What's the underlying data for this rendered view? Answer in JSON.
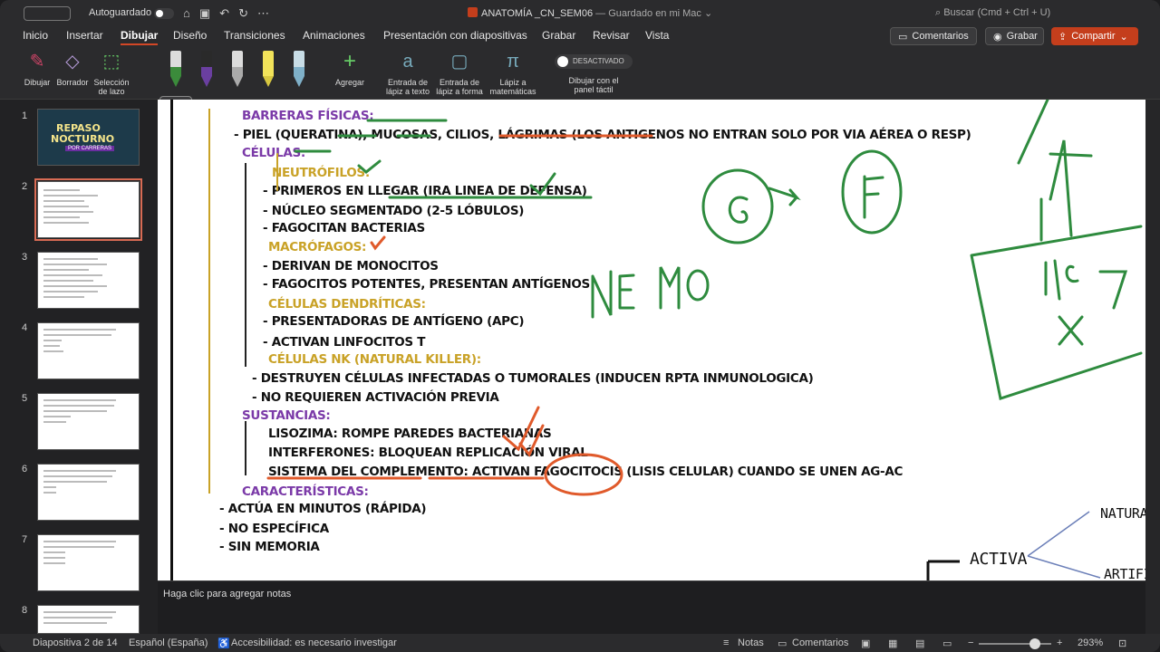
{
  "titlebar": {
    "autosave_label": "Autoguardado",
    "doc_title": "ANATOMÍA _CN_SEM06",
    "doc_status": " — Guardado en mi Mac ⌄",
    "search_label": "Buscar (Cmd + Ctrl + U)"
  },
  "menu": {
    "items": [
      "Inicio",
      "Insertar",
      "Dibujar",
      "Diseño",
      "Transiciones",
      "Animaciones",
      "Presentación con diapositivas",
      "Grabar",
      "Revisar",
      "Vista"
    ],
    "active": "Dibujar"
  },
  "header_buttons": {
    "comments": "Comentarios",
    "record": "Grabar",
    "share": "Compartir"
  },
  "ribbon": {
    "draw": "Dibujar",
    "eraser": "Borrador",
    "lasso": "Selección de lazo",
    "add": "Agregar",
    "ink_to_text": "Entrada de lápiz a texto",
    "ink_to_shape": "Entrada de lápiz a forma",
    "ink_to_math": "Lápiz a matemáticas",
    "touch_toggle": "DESACTIVADO",
    "touch_label": "Dibujar con el panel táctil",
    "pen_colors": [
      "#3b8b3b",
      "#6a3fa0",
      "#cfcfcf",
      "#f2e35a",
      "#7fb0c8"
    ]
  },
  "thumbnails": {
    "numbers": [
      "1",
      "2",
      "3",
      "4",
      "5",
      "6",
      "7",
      "8"
    ],
    "slide1_title_1": "REPASO",
    "slide1_title_2": "NOCTURNO",
    "slide1_sub": "POR CARRERAS"
  },
  "slide": {
    "lines": [
      "BARRERAS FÍSICAS:",
      "- PIEL (QUERATINA), MUCOSAS, CILIOS, LÁGRIMAS (LOS ANTIGENOS NO ENTRAN SOLO POR VIA AÉREA O RESP)",
      "CÉLULAS:",
      "NEUTRÓFILOS:",
      "- PRIMEROS EN LLEGAR (IRA LINEA DE DEFENSA)",
      "- NÚCLEO SEGMENTADO (2-5 LÓBULOS)",
      "- FAGOCITAN BACTERIAS",
      "MACRÓFAGOS:",
      "- DERIVAN DE MONOCITOS",
      "- FAGOCITOS POTENTES, PRESENTAN ANTÍGENOS",
      "CÉLULAS DENDRÍTICAS:",
      "- PRESENTADORAS DE ANTÍGENO (APC)",
      "- ACTIVAN LINFOCITOS T",
      "CÉLULAS NK (NATURAL KILLER):",
      "- DESTRUYEN CÉLULAS INFECTADAS O TUMORALES (INDUCEN RPTA INMUNOLOGICA)",
      "- NO REQUIEREN ACTIVACIÓN PREVIA",
      "SUSTANCIAS:",
      "LISOZIMA: ROMPE PAREDES BACTERIANAS",
      "INTERFERONES: BLOQUEAN REPLICACIÓN VIRAL",
      "SISTEMA DEL COMPLEMENTO: ACTIVAN FAGOCITOCIS (LISIS CELULAR) CUANDO SE UNEN AG-AC",
      "CARACTERÍSTICAS:",
      "- ACTÚA EN MINUTOS (RÁPIDA)",
      "- NO ESPECÍFICA",
      "- SIN MEMORIA"
    ],
    "right_labels": [
      "NATURA",
      "ACTIVA",
      "ARTIFI"
    ],
    "handwriting": [
      "G",
      "+A",
      "F",
      "NE",
      "MO",
      "19",
      "7"
    ]
  },
  "notes_placeholder": "Haga clic para agregar notas",
  "status": {
    "slide_count": "Diapositiva 2 de 14",
    "language": "Español (España)",
    "accessibility": "Accesibilidad: es necesario investigar",
    "notes": "Notas",
    "comments": "Comentarios",
    "zoom": "293%"
  }
}
